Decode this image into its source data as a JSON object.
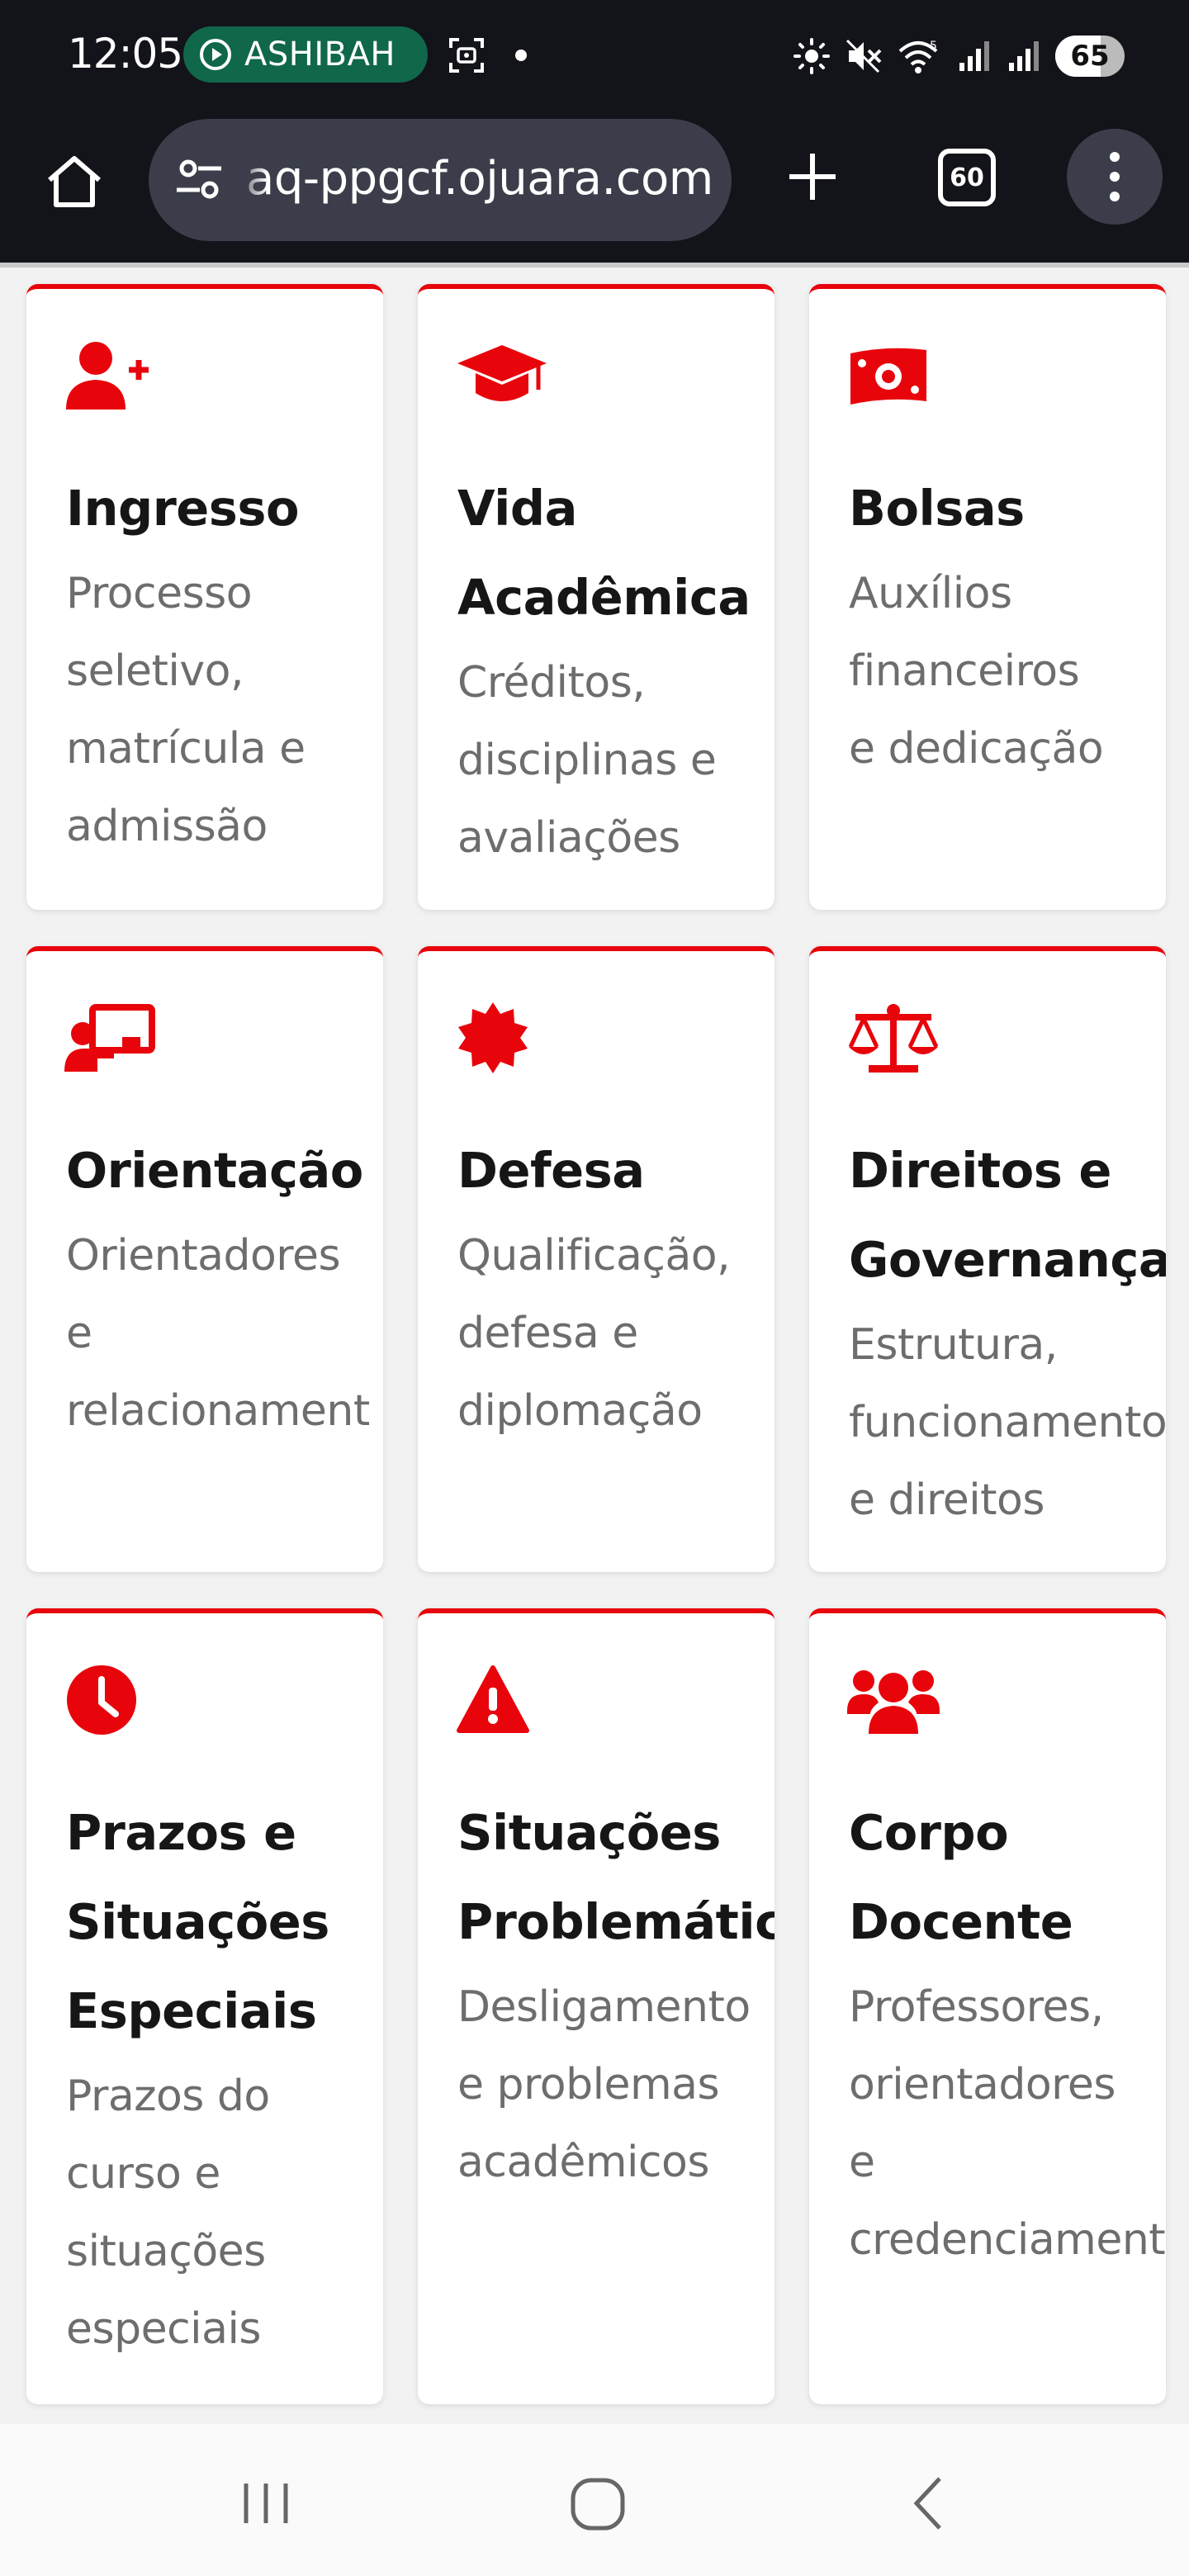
{
  "status_bar": {
    "time": "12:05",
    "recording_app": "ASHIBAH",
    "battery": "65",
    "battery_level_percent": 65,
    "icons": [
      "screenshot-icon",
      "notification-dot-icon",
      "brightness-icon",
      "mute-icon",
      "wifi-icon",
      "signal-icon",
      "signal-icon",
      "battery-icon"
    ]
  },
  "browser": {
    "url": "aq-ppgcf.ojuara.com",
    "tab_count": "60",
    "icons": [
      "home-icon",
      "site-settings-icon",
      "plus-icon",
      "tabs-icon",
      "more-vertical-icon"
    ]
  },
  "theme": {
    "accent": "#e8040b",
    "title_color": "#161616",
    "text_color": "#6d6d6d",
    "chrome_bg": "#13131a"
  },
  "cards": [
    {
      "icon": "user-plus-icon",
      "title": [
        "Ingresso"
      ],
      "description": [
        "Processo",
        "seletivo,",
        "matrícula e",
        "admissão"
      ]
    },
    {
      "icon": "graduation-cap-icon",
      "title": [
        "Vida",
        "Acadêmica"
      ],
      "description": [
        "Créditos,",
        "disciplinas e",
        "avaliações"
      ]
    },
    {
      "icon": "money-bill-icon",
      "title": [
        "Bolsas"
      ],
      "description": [
        "Auxílios",
        "financeiros",
        "e dedicação"
      ]
    },
    {
      "icon": "chalkboard-teacher-icon",
      "title": [
        "Orientação"
      ],
      "description": [
        "Orientadores",
        "e",
        "relacionament"
      ]
    },
    {
      "icon": "certificate-badge-icon",
      "title": [
        "Defesa"
      ],
      "description": [
        "Qualificação,",
        "defesa e",
        "diplomação"
      ]
    },
    {
      "icon": "balance-scale-icon",
      "title": [
        "Direitos e",
        "Governança"
      ],
      "description": [
        "Estrutura,",
        "funcionamento",
        "e direitos"
      ]
    },
    {
      "icon": "clock-icon",
      "title": [
        "Prazos e",
        "Situações",
        "Especiais"
      ],
      "description": [
        "Prazos do",
        "curso e",
        "situações",
        "especiais"
      ]
    },
    {
      "icon": "warning-triangle-icon",
      "title": [
        "Situações",
        "Problemátic"
      ],
      "description": [
        "Desligamento",
        "e problemas",
        "acadêmicos"
      ]
    },
    {
      "icon": "users-icon",
      "title": [
        "Corpo",
        "Docente"
      ],
      "description": [
        "Professores,",
        "orientadores",
        "e",
        "credenciament"
      ]
    }
  ],
  "nav_bar": {
    "icons": [
      "recent-apps-icon",
      "home-circle-icon",
      "back-icon"
    ]
  }
}
